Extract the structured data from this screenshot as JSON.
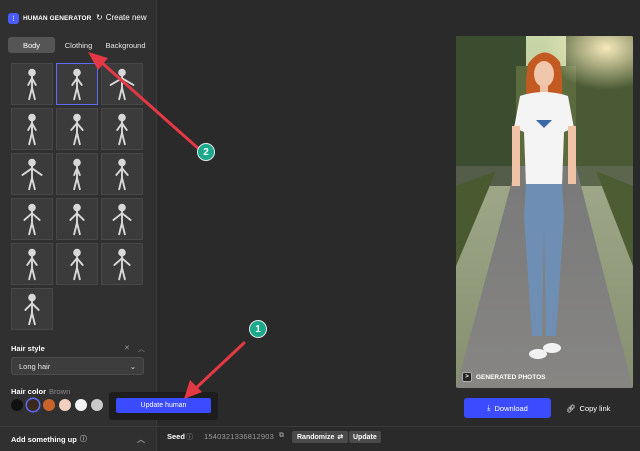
{
  "app": {
    "brand": "HUMAN GENERATOR",
    "create_new": "Create new"
  },
  "tabs": [
    {
      "label": "Body",
      "active": true
    },
    {
      "label": "Clothing",
      "active": false
    },
    {
      "label": "Background",
      "active": false
    }
  ],
  "poses": [
    {
      "name": "pose-1",
      "selected": false
    },
    {
      "name": "pose-2",
      "selected": true
    },
    {
      "name": "pose-3",
      "selected": false
    },
    {
      "name": "pose-4",
      "selected": false
    },
    {
      "name": "pose-5",
      "selected": false
    },
    {
      "name": "pose-6",
      "selected": false
    },
    {
      "name": "pose-7",
      "selected": false
    },
    {
      "name": "pose-8",
      "selected": false
    },
    {
      "name": "pose-9",
      "selected": false
    },
    {
      "name": "pose-10",
      "selected": false
    },
    {
      "name": "pose-11",
      "selected": false
    },
    {
      "name": "pose-12",
      "selected": false
    },
    {
      "name": "pose-13",
      "selected": false
    },
    {
      "name": "pose-14",
      "selected": false
    },
    {
      "name": "pose-15",
      "selected": false
    },
    {
      "name": "pose-16",
      "selected": false
    }
  ],
  "hair_style": {
    "heading": "Hair style",
    "value": "Long hair",
    "clear_icon": "close-icon",
    "collapse_icon": "chevron-up-icon"
  },
  "hair_color": {
    "heading": "Hair color",
    "value": "Brown",
    "swatches": [
      "#111111",
      "#3a2a1e",
      "#c8632c",
      "#f2d0bf",
      "#f4f4f4",
      "#c9c9c9"
    ],
    "selected_index": 1
  },
  "update_human": "Update human",
  "add_something": "Add something up",
  "badge": "GENERATED PHOTOS",
  "download": "Download",
  "copy_link": "Copy link",
  "seed": {
    "label": "Seed",
    "value": "1540321336812903",
    "randomize": "Randomize",
    "update": "Update"
  },
  "annotations": [
    {
      "number": "1",
      "color": "#1aa98a"
    },
    {
      "number": "2",
      "color": "#1aa98a"
    }
  ],
  "colors": {
    "accent": "#3b4bff",
    "arrow": "#e53845",
    "sidebar_bg": "#303030",
    "main_bg": "#2a2a2a"
  }
}
